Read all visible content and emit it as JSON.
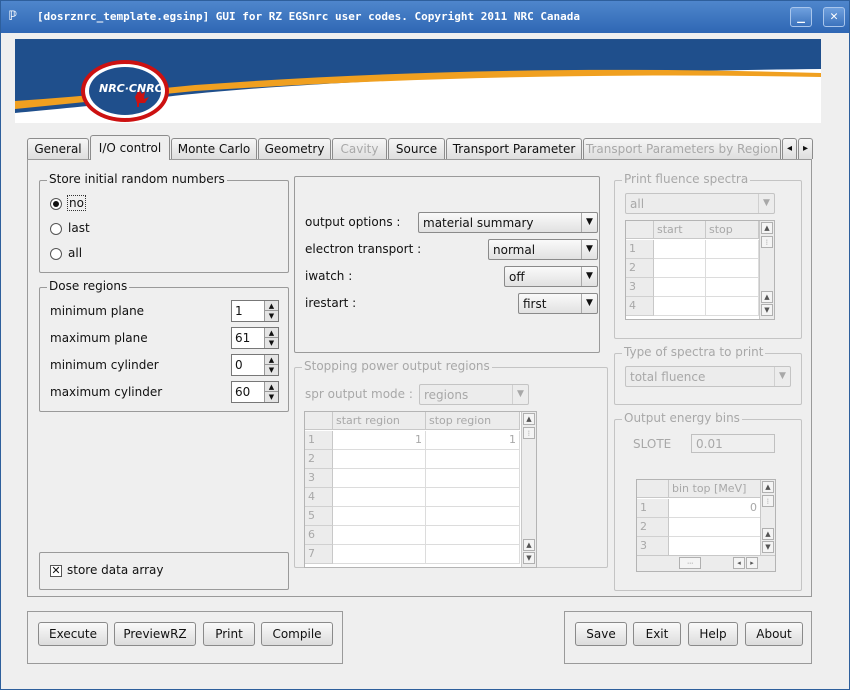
{
  "window": {
    "title": "[dosrznrc_template.egsinp] GUI for RZ EGSnrc user codes. Copyright 2011 NRC Canada",
    "minimize": "_",
    "close": "✕"
  },
  "banner": {
    "logo_text": "NRC·CNRC"
  },
  "tabs": [
    "General",
    "I/O control",
    "Monte Carlo",
    "Geometry",
    "Cavity",
    "Source",
    "Transport Parameter",
    "Transport Parameters by Region"
  ],
  "tab_scroll": {
    "left": "◂",
    "right": "▸"
  },
  "store_random": {
    "title": "Store initial random numbers",
    "options": [
      "no",
      "last",
      "all"
    ],
    "selected": "no"
  },
  "dose_regions": {
    "title": "Dose regions",
    "rows": [
      {
        "label": "minimum plane",
        "value": "1"
      },
      {
        "label": "maximum plane",
        "value": "61"
      },
      {
        "label": "minimum cylinder",
        "value": "0"
      },
      {
        "label": "maximum cylinder",
        "value": "60"
      }
    ]
  },
  "store_data_array": {
    "label": "store data array",
    "checked": true
  },
  "output": {
    "rows": [
      {
        "label": "output options :",
        "value": "material summary"
      },
      {
        "label": "electron transport :",
        "value": "normal"
      },
      {
        "label": "iwatch :",
        "value": "off"
      },
      {
        "label": "irestart :",
        "value": "first"
      }
    ]
  },
  "spr": {
    "title": "Stopping power output regions",
    "mode_label": "spr output mode :",
    "mode_value": "regions",
    "headers": [
      "start region",
      "stop region"
    ],
    "row_numbers": [
      "1",
      "2",
      "3",
      "4",
      "5",
      "6",
      "7"
    ],
    "first_row": [
      "1",
      "1"
    ]
  },
  "fluence": {
    "title": "Print fluence spectra",
    "value": "all",
    "headers": [
      "start",
      "stop"
    ],
    "row_numbers": [
      "1",
      "2",
      "3",
      "4"
    ]
  },
  "spectra_type": {
    "title": "Type of spectra to print",
    "value": "total fluence"
  },
  "energy_bins": {
    "title": "Output energy bins",
    "slote_label": "SLOTE",
    "slote_value": "0.01",
    "header": "bin top [MeV]",
    "row_numbers": [
      "1",
      "2",
      "3"
    ],
    "first_value": "0"
  },
  "buttons_left": [
    "Execute",
    "PreviewRZ",
    "Print",
    "Compile"
  ],
  "buttons_right": [
    "Save",
    "Exit",
    "Help",
    "About"
  ],
  "colors": {
    "title_bar": "#2f67b4",
    "banner_blue": "#1f4f8c",
    "banner_orange": "#f0a020",
    "logo_red": "#cc1111"
  }
}
